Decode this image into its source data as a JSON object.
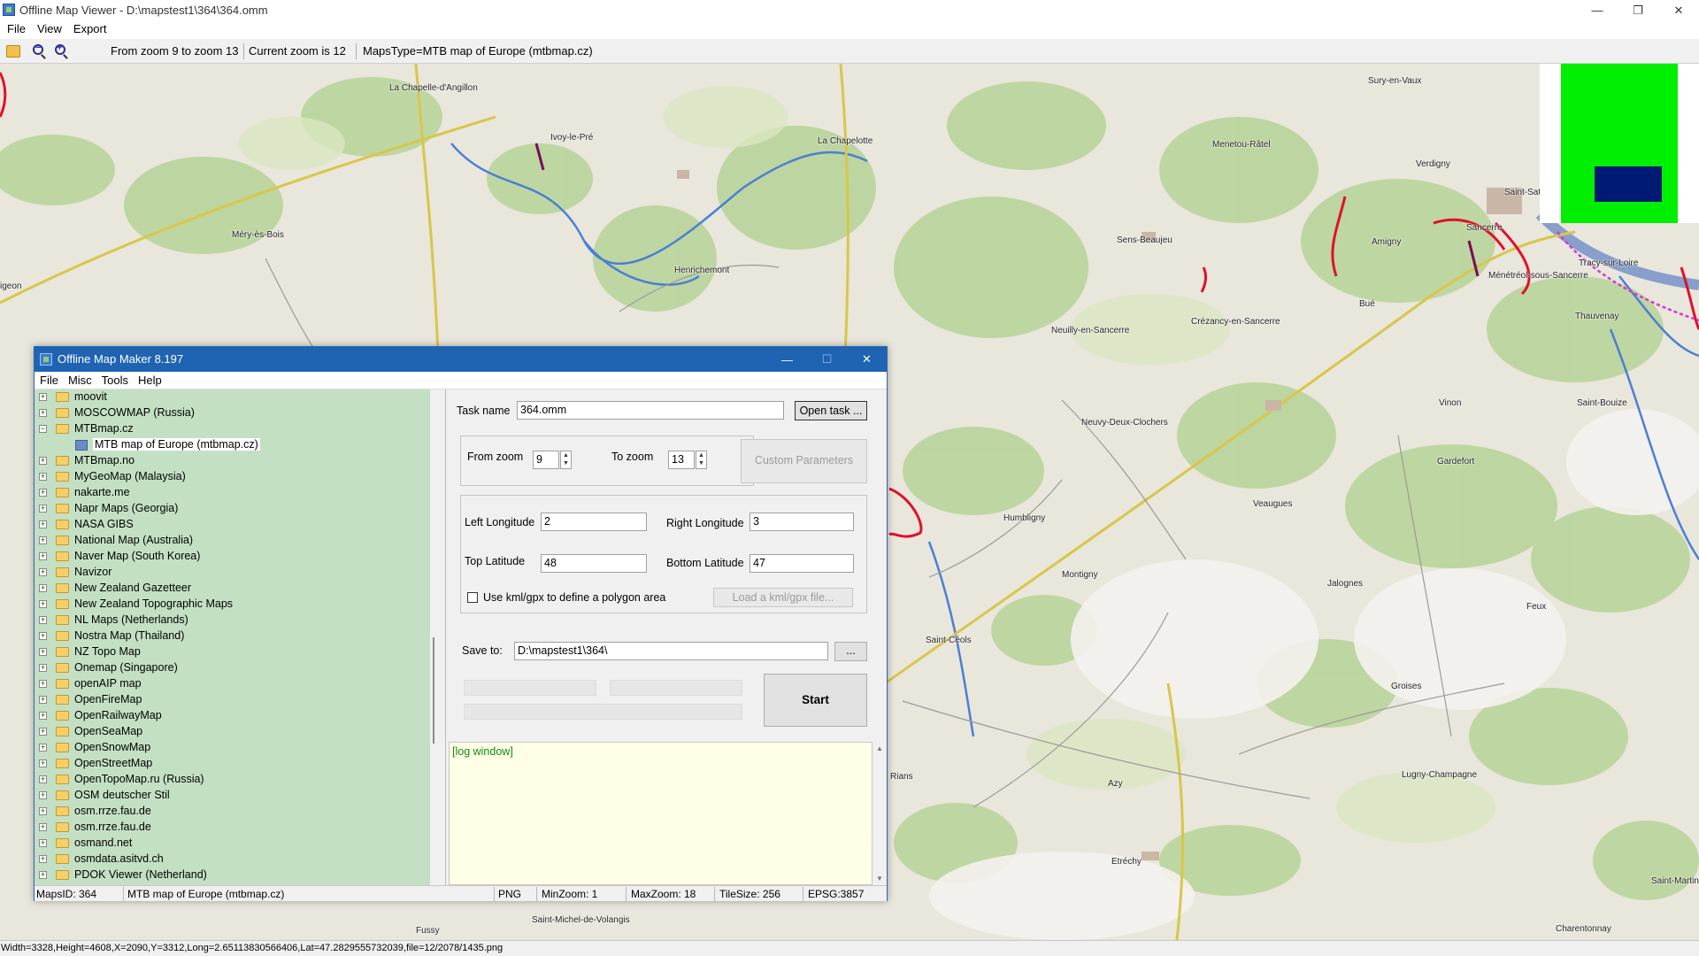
{
  "window": {
    "title": "Offline Map Viewer - D:\\mapstest1\\364\\364.omm",
    "controls": {
      "minimize": "—",
      "restore": "❐",
      "close": "✕"
    }
  },
  "menubar": {
    "items": [
      "File",
      "View",
      "Export"
    ]
  },
  "toolbar": {
    "zoom_range": "From zoom 9 to zoom 13",
    "current_zoom": "Current zoom is 12",
    "maps_type": "MapsType=MTB map of Europe (mtbmap.cz)"
  },
  "map": {
    "places": [
      "La Chapelle-d'Angillon",
      "Ivoy-le-Pré",
      "Méry-ès-Bois",
      "Henrichemont",
      "La Chapelotte",
      "Sens-Beaujeu",
      "Menetou-Râtel",
      "Verdigny",
      "Sury-en-Vaux",
      "Saint-Satur",
      "Sancerre",
      "Amigny",
      "Ménétréol-sous-Sancerre",
      "Tracy-sur-Loire",
      "Bué",
      "Crézancy-en-Sancerre",
      "Neuilly-en-Sancerre",
      "Thauvenay",
      "Neuvy-Deux-Clochers",
      "Vinon",
      "Saint-Bouize",
      "Humbligny",
      "Veaugues",
      "Gardefort",
      "Montigny",
      "Jalognes",
      "Feux",
      "Saint-Céols",
      "Groises",
      "Rians",
      "Azy",
      "Lugny-Champagne",
      "Etréchy",
      "Saint-Michel-de-Volangis",
      "Fussy",
      "Charentonnay",
      "Saint-Martin-des-Champs",
      "igeon"
    ]
  },
  "status": "Width=3328,Height=4608,X=2090,Y=3312,Long=2.65113830566406,Lat=47.2829555732039,file=12/2078/1435.png",
  "dialog": {
    "title": "Offline Map Maker 8.197",
    "controls": {
      "minimize": "—",
      "maximize": "☐",
      "close": "✕"
    },
    "menu": [
      "File",
      "Misc",
      "Tools",
      "Help"
    ],
    "tree": [
      {
        "label": "moovit",
        "sign": "+"
      },
      {
        "label": "MOSCOWMAP (Russia)",
        "sign": "+"
      },
      {
        "label": "MTBmap.cz",
        "sign": "−"
      },
      {
        "label": "MTB map of Europe (mtbmap.cz)",
        "child": true
      },
      {
        "label": "MTBmap.no",
        "sign": "+"
      },
      {
        "label": "MyGeoMap (Malaysia)",
        "sign": "+"
      },
      {
        "label": "nakarte.me",
        "sign": "+"
      },
      {
        "label": "Napr Maps (Georgia)",
        "sign": "+"
      },
      {
        "label": "NASA GIBS",
        "sign": "+"
      },
      {
        "label": "National Map (Australia)",
        "sign": "+"
      },
      {
        "label": "Naver Map (South Korea)",
        "sign": "+"
      },
      {
        "label": "Navizor",
        "sign": "+"
      },
      {
        "label": "New Zealand Gazetteer",
        "sign": "+"
      },
      {
        "label": "New Zealand Topographic Maps",
        "sign": "+"
      },
      {
        "label": "NL Maps (Netherlands)",
        "sign": "+"
      },
      {
        "label": "Nostra Map (Thailand)",
        "sign": "+"
      },
      {
        "label": "NZ Topo Map",
        "sign": "+"
      },
      {
        "label": "Onemap (Singapore)",
        "sign": "+"
      },
      {
        "label": "openAIP map",
        "sign": "+"
      },
      {
        "label": "OpenFireMap",
        "sign": "+"
      },
      {
        "label": "OpenRailwayMap",
        "sign": "+"
      },
      {
        "label": "OpenSeaMap",
        "sign": "+"
      },
      {
        "label": "OpenSnowMap",
        "sign": "+"
      },
      {
        "label": "OpenStreetMap",
        "sign": "+"
      },
      {
        "label": "OpenTopoMap.ru (Russia)",
        "sign": "+"
      },
      {
        "label": "OSM deutscher Stil",
        "sign": "+"
      },
      {
        "label": "osm.rrze.fau.de",
        "sign": "+"
      },
      {
        "label": "osm.rrze.fau.de",
        "sign": "+"
      },
      {
        "label": "osmand.net",
        "sign": "+"
      },
      {
        "label": "osmdata.asitvd.ch",
        "sign": "+"
      },
      {
        "label": "PDOK Viewer (Netherland)",
        "sign": "+"
      }
    ],
    "form": {
      "task_name_label": "Task name",
      "task_name_value": "364.omm",
      "open_task": "Open task ...",
      "from_zoom_label": "From zoom",
      "from_zoom_value": "9",
      "to_zoom_label": "To zoom",
      "to_zoom_value": "13",
      "custom_params": "Custom Parameters",
      "left_lon_label": "Left Longitude",
      "left_lon_value": "2",
      "right_lon_label": "Right Longitude",
      "right_lon_value": "3",
      "top_lat_label": "Top Latitude",
      "top_lat_value": "48",
      "bottom_lat_label": "Bottom Latitude",
      "bottom_lat_value": "47",
      "kml_checkbox_label": "Use kml/gpx to define a polygon area",
      "load_kml": "Load a kml/gpx file...",
      "save_to_label": "Save to:",
      "save_to_value": "D:\\mapstest1\\364\\",
      "browse": "...",
      "start": "Start"
    },
    "log_text": "[log window]",
    "statusbar": {
      "maps_id": "MapsID: 364",
      "map_name": "MTB map of Europe (mtbmap.cz)",
      "format": "PNG",
      "min_zoom": "MinZoom: 1",
      "max_zoom": "MaxZoom: 18",
      "tile_size": "TileSize: 256",
      "epsg": "EPSG:3857"
    }
  }
}
